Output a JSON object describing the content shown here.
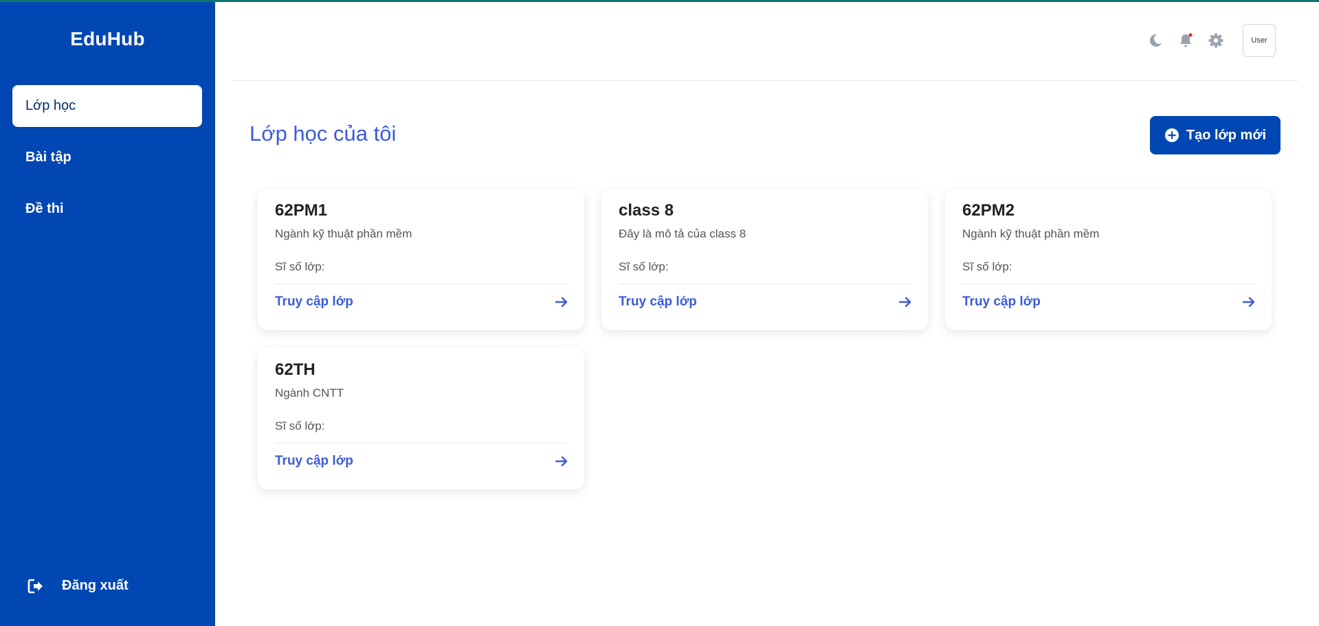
{
  "app": {
    "brand": "EduHub"
  },
  "sidebar": {
    "items": [
      {
        "label": "Lớp học",
        "active": true
      },
      {
        "label": "Bài tập",
        "active": false
      },
      {
        "label": "Đề thi",
        "active": false
      }
    ],
    "logout_label": "Đăng xuất"
  },
  "header": {
    "icons": [
      "moon-icon",
      "bell-icon",
      "gear-icon"
    ],
    "avatar_label": "User",
    "notification_dot_color": "#e03131"
  },
  "main": {
    "title": "Lớp học của tôi",
    "create_button_label": "Tạo lớp mới",
    "classes": [
      {
        "name": "62PM1",
        "description": "Ngành kỹ thuật phần mềm",
        "count_label": "Sĩ số lớp:",
        "link_label": "Truy cập lớp"
      },
      {
        "name": "class 8",
        "description": "Đây là mô tả của class 8",
        "count_label": "Sĩ số lớp:",
        "link_label": "Truy cập lớp"
      },
      {
        "name": "62PM2",
        "description": "Ngành kỹ thuật phần mềm",
        "count_label": "Sĩ số lớp:",
        "link_label": "Truy cập lớp"
      },
      {
        "name": "62TH",
        "description": "Ngành CNTT",
        "count_label": "Sĩ số lớp:",
        "link_label": "Truy cập lớp"
      }
    ]
  },
  "colors": {
    "sidebar_bg": "#0047b3",
    "accent": "#3b5bdb",
    "top_border": "#0f766e"
  }
}
